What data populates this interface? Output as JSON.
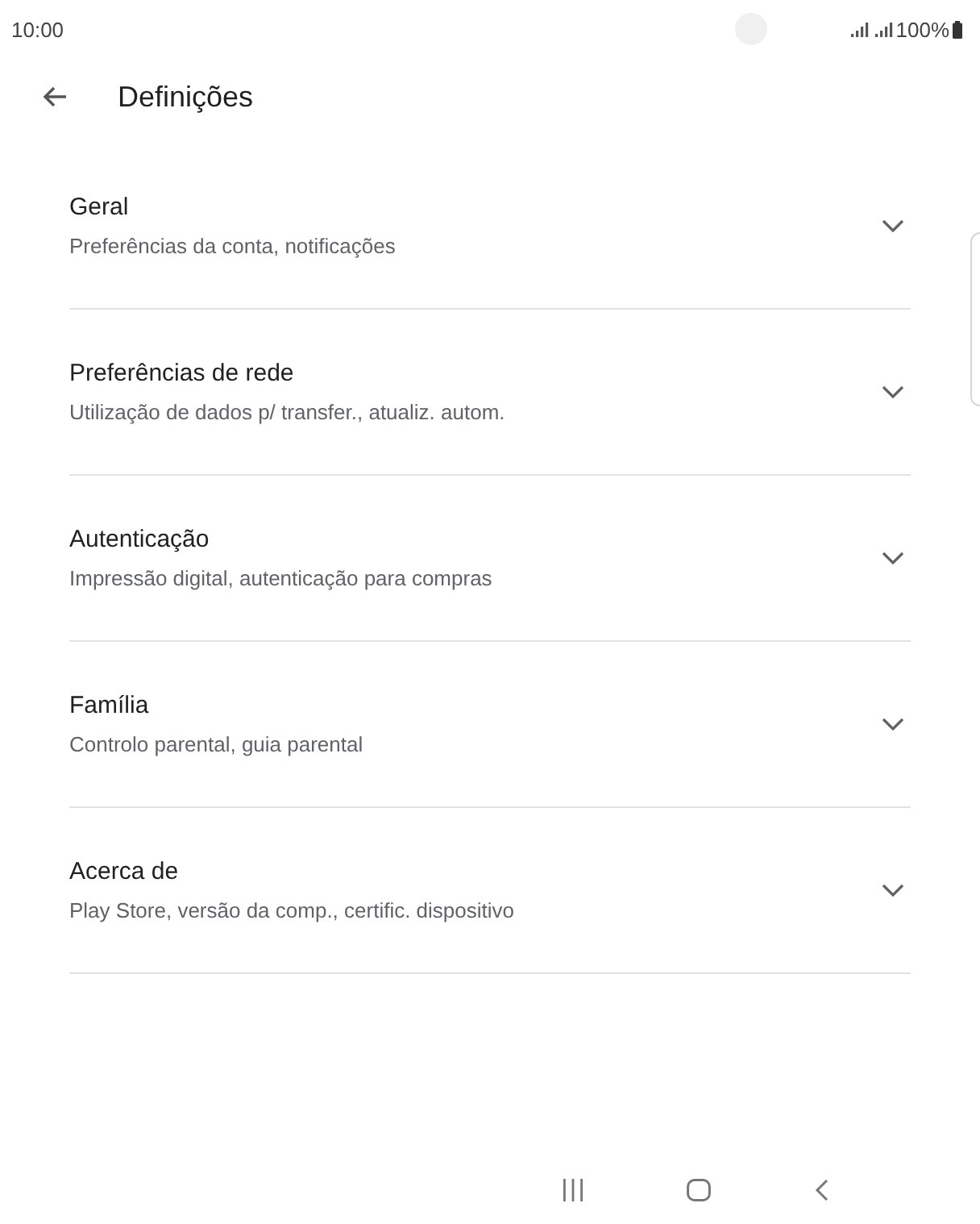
{
  "status_bar": {
    "time": "10:00",
    "battery": "100%"
  },
  "header": {
    "title": "Definições"
  },
  "sections": [
    {
      "title": "Geral",
      "subtitle": "Preferências da conta, notificações",
      "expanded": false
    },
    {
      "title": "Preferências de rede",
      "subtitle": "Utilização de dados p/ transfer., atualiz. autom.",
      "expanded": false
    },
    {
      "title": "Autenticação",
      "subtitle": "Impressão digital, autenticação para compras",
      "expanded": false
    },
    {
      "title": "Família",
      "subtitle": "Controlo parental, guia parental",
      "expanded": false
    },
    {
      "title": "Acerca de",
      "subtitle": "Play Store, versão da comp., certific. dispositivo",
      "expanded": false
    }
  ]
}
